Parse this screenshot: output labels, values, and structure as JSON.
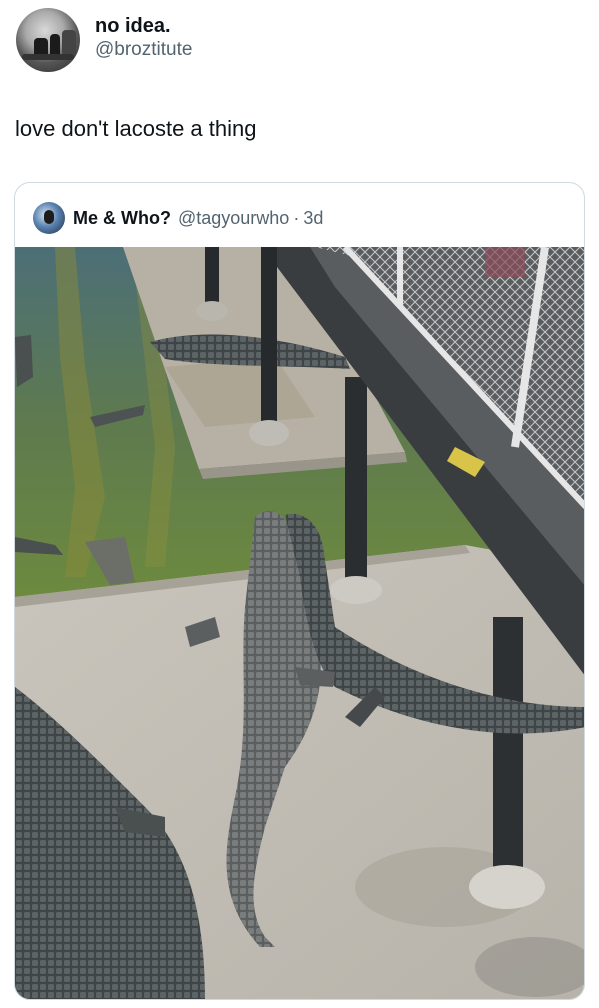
{
  "author": {
    "display_name": "no idea.",
    "handle": "@broztitute"
  },
  "tweet": {
    "text": "love don't lacoste a thing"
  },
  "quoted_tweet": {
    "display_name": "Me & Who?",
    "handle": "@tagyourwho",
    "separator": "·",
    "time": "3d"
  },
  "colors": {
    "text_primary": "#0f1419",
    "text_secondary": "#536471",
    "border": "#cfd9de"
  }
}
